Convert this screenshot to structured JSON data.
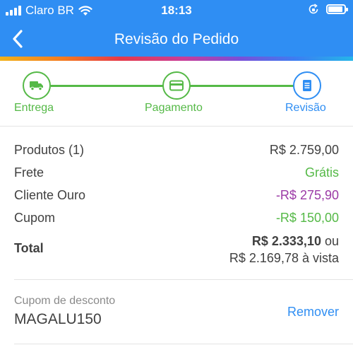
{
  "status_bar": {
    "carrier": "Claro BR",
    "time": "18:13"
  },
  "header": {
    "title": "Revisão do Pedido"
  },
  "steps": [
    {
      "label": "Entrega",
      "icon": "truck-icon",
      "state": "done"
    },
    {
      "label": "Pagamento",
      "icon": "card-icon",
      "state": "done"
    },
    {
      "label": "Revisão",
      "icon": "document-icon",
      "state": "active"
    }
  ],
  "summary": {
    "rows": [
      {
        "label": "Produtos (1)",
        "value": "R$ 2.759,00",
        "color": "#404040"
      },
      {
        "label": "Frete",
        "value": "Grátis",
        "color": "#55b947"
      },
      {
        "label": "Cliente Ouro",
        "value": "-R$ 275,90",
        "color": "#9b3aa6"
      },
      {
        "label": "Cupom",
        "value": "-R$ 150,00",
        "color": "#55b947"
      }
    ],
    "total_label": "Total",
    "total_value": "R$ 2.333,10",
    "total_or": "ou",
    "total_cash": "R$ 2.169,78 à vista"
  },
  "coupon": {
    "caption": "Cupom de desconto",
    "code": "MAGALU150",
    "remove_label": "Remover"
  },
  "colors": {
    "brand_blue": "#2f8ef3",
    "success_green": "#55b947",
    "gold_purple": "#9b3aa6"
  }
}
